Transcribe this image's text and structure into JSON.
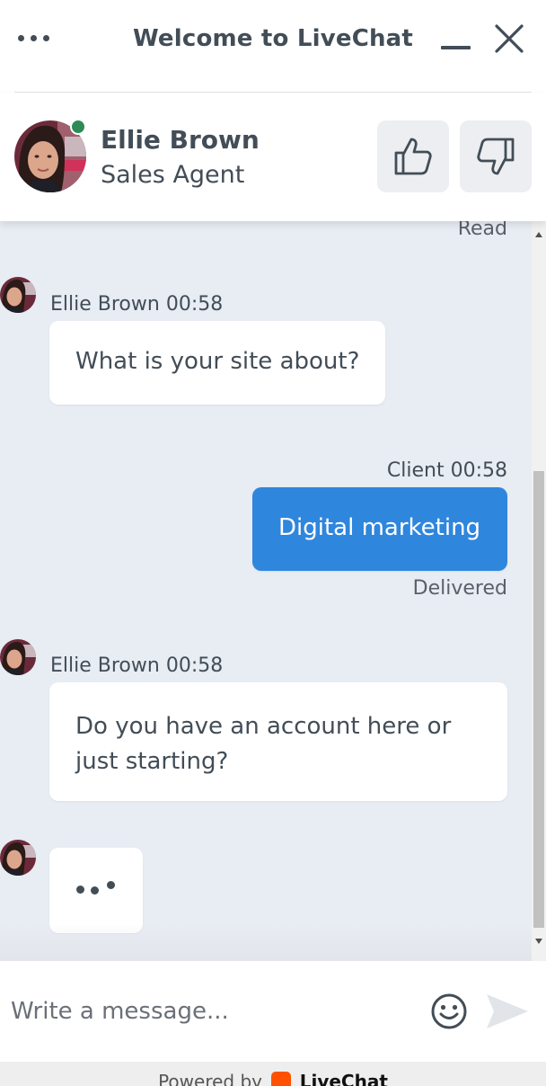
{
  "window": {
    "title": "Welcome to LiveChat"
  },
  "agent": {
    "name": "Ellie Brown",
    "role": "Sales Agent",
    "status": "online",
    "status_color": "#2e8b57"
  },
  "icons": {
    "menu": "more-dots-icon",
    "minimize": "minimize-icon",
    "close": "close-icon",
    "rate_good": "thumbs-up-icon",
    "rate_bad": "thumbs-down-icon",
    "emoji": "smiley-icon",
    "send": "paper-plane-icon"
  },
  "messages": {
    "previous_status": "Read",
    "m1": {
      "author": "Ellie Brown",
      "time": "00:58",
      "text": "What is your site about?"
    },
    "m2": {
      "author": "Client",
      "time": "00:58",
      "text": "Digital marketing",
      "status": "Delivered"
    },
    "m3": {
      "author": "Ellie Brown",
      "time": "00:58",
      "line1": "Do you have an account here or",
      "line2": "just starting?"
    },
    "typing": true
  },
  "composer": {
    "placeholder": "Write a message..."
  },
  "footer": {
    "powered_by": "Powered by",
    "brand": "LiveChat"
  },
  "colors": {
    "accent": "#2f86dd",
    "chat_background": "#e8ecf3",
    "text": "#424d57",
    "brand": "#ff5100"
  }
}
